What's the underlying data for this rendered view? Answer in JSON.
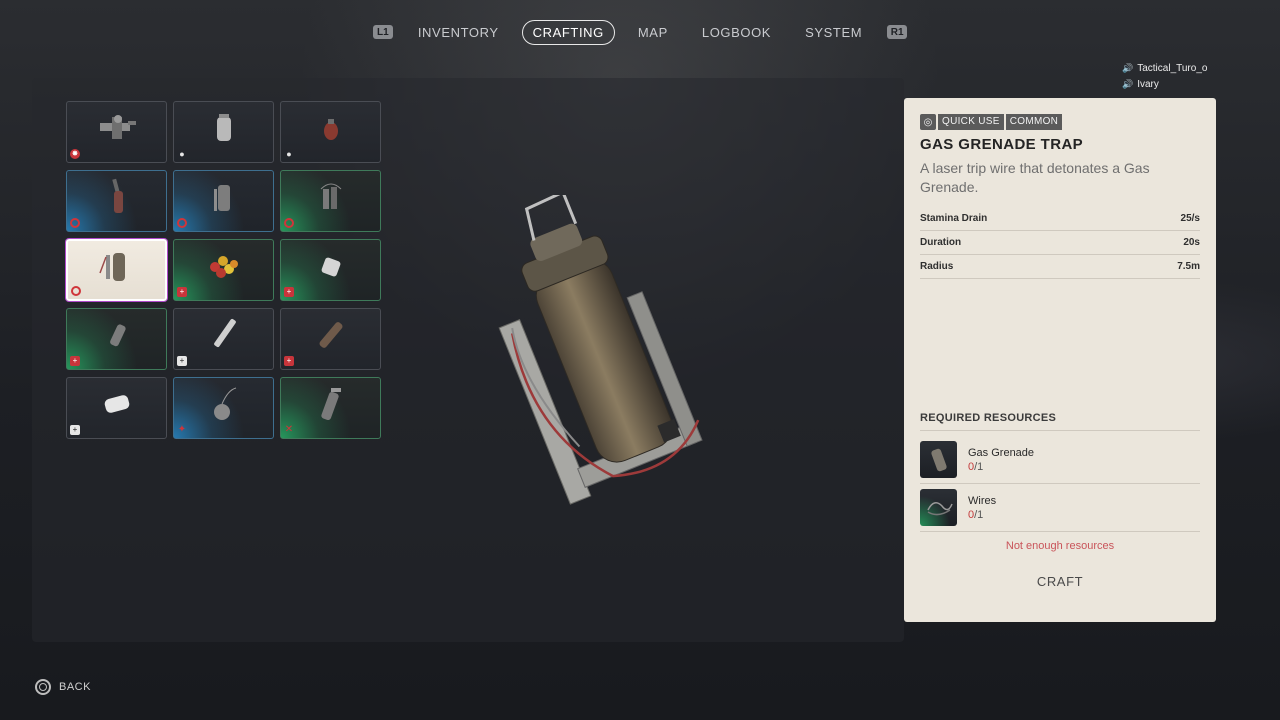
{
  "nav": {
    "left_bumper": "L1",
    "right_bumper": "R1",
    "tabs": [
      {
        "label": "INVENTORY",
        "active": false
      },
      {
        "label": "CRAFTING",
        "active": true
      },
      {
        "label": "MAP",
        "active": false
      },
      {
        "label": "LOGBOOK",
        "active": false
      },
      {
        "label": "SYSTEM",
        "active": false
      }
    ]
  },
  "players": [
    "Tactical_Turo_o",
    "Ivary"
  ],
  "grid": {
    "slots": [
      {
        "icon": "grenade-launcher-icon",
        "rarity": "none",
        "badge": "gear"
      },
      {
        "icon": "canister-icon",
        "rarity": "none",
        "badge": "pill"
      },
      {
        "icon": "frag-grenade-icon",
        "rarity": "none",
        "badge": "pill"
      },
      {
        "icon": "molotov-icon",
        "rarity": "blue",
        "badge": "ring"
      },
      {
        "icon": "gas-trap-icon",
        "rarity": "blue",
        "badge": "ring"
      },
      {
        "icon": "cluster-trap-icon",
        "rarity": "green",
        "badge": "ring"
      },
      {
        "icon": "gas-grenade-trap-icon",
        "rarity": "selected",
        "badge": "ring"
      },
      {
        "icon": "berries-icon",
        "rarity": "green",
        "badge": "red-cross"
      },
      {
        "icon": "bandage-roll-icon",
        "rarity": "green",
        "badge": "red-cross"
      },
      {
        "icon": "ointment-icon",
        "rarity": "green",
        "badge": "red-cross"
      },
      {
        "icon": "syringe-icon",
        "rarity": "none",
        "badge": "white-cross"
      },
      {
        "icon": "vial-icon",
        "rarity": "none",
        "badge": "red-cross"
      },
      {
        "icon": "gauze-icon",
        "rarity": "none",
        "badge": "white-cross"
      },
      {
        "icon": "bomb-icon",
        "rarity": "blue",
        "badge": "tool"
      },
      {
        "icon": "sprayer-icon",
        "rarity": "green",
        "badge": "tool"
      }
    ]
  },
  "item": {
    "tags": [
      "QUICK USE",
      "COMMON"
    ],
    "title": "GAS GRENADE TRAP",
    "description": "A laser trip wire that detonates a Gas Grenade.",
    "stats": [
      {
        "label": "Stamina Drain",
        "value": "25/s"
      },
      {
        "label": "Duration",
        "value": "20s"
      },
      {
        "label": "Radius",
        "value": "7.5m"
      }
    ],
    "required_header": "REQUIRED RESOURCES",
    "resources": [
      {
        "name": "Gas Grenade",
        "have": "0",
        "need": "/1"
      },
      {
        "name": "Wires",
        "have": "0",
        "need": "/1"
      }
    ],
    "warning": "Not enough resources",
    "craft_label": "CRAFT"
  },
  "back_label": "BACK",
  "colors": {
    "accent_red": "#c8353b",
    "card_bg": "#ebe6dc",
    "rarity_blue": "#2896dc",
    "rarity_green": "#28be6e"
  }
}
